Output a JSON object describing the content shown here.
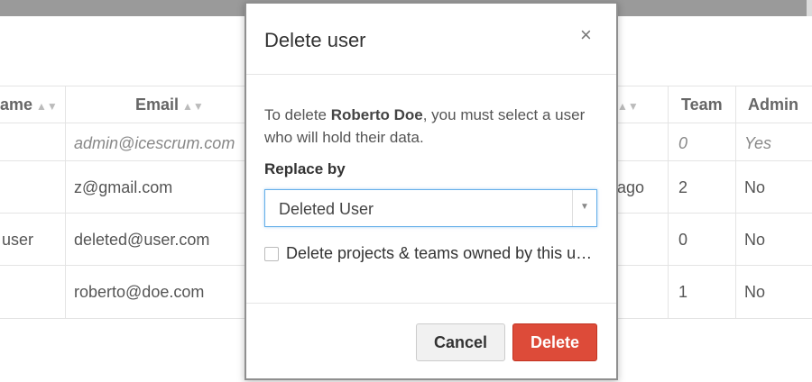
{
  "table": {
    "headers": {
      "name": "ame",
      "email": "Email",
      "teams": "Team",
      "admin": "Admin"
    },
    "rows": [
      {
        "name": "",
        "email": "admin@icescrum.com",
        "last_login": "",
        "teams": "0",
        "admin": "Yes",
        "italic": true
      },
      {
        "name": "",
        "email": "z@gmail.com",
        "last_login": "ago",
        "teams": "2",
        "admin": "No",
        "italic": false
      },
      {
        "name": "user",
        "email": "deleted@user.com",
        "last_login": "",
        "teams": "0",
        "admin": "No",
        "italic": false
      },
      {
        "name": "",
        "email": "roberto@doe.com",
        "last_login": "",
        "teams": "1",
        "admin": "No",
        "italic": false
      }
    ]
  },
  "modal": {
    "title": "Delete user",
    "close_glyph": "×",
    "desc_prefix": "To delete ",
    "user_name": "Roberto Doe",
    "desc_suffix": ", you must select a user who will hold their data.",
    "replace_label": "Replace by",
    "replace_selected": "Deleted User",
    "checkbox_label": "Delete projects & teams owned by this user",
    "checkbox_checked": false,
    "cancel_label": "Cancel",
    "delete_label": "Delete"
  },
  "colors": {
    "delete_button": "#dd4b39",
    "select_focus": "#66afe9"
  }
}
